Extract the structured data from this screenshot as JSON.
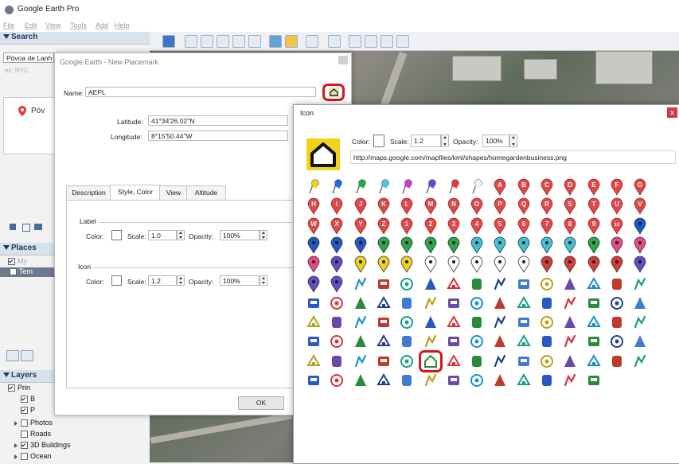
{
  "app": {
    "title": "Google Earth Pro"
  },
  "menu": [
    "File",
    "Edit",
    "View",
    "Tools",
    "Add",
    "Help"
  ],
  "sidebar": {
    "search_header": "Search",
    "search_value": "Póvoa de Lanh",
    "search_hint": "ex: NYC",
    "result_label": "Póv",
    "places_header": "Places",
    "places_items": [
      {
        "label": "My"
      },
      {
        "label": "Tem"
      }
    ],
    "layers_header": "Layers",
    "layers_items": [
      {
        "label": "Prin"
      },
      {
        "label": "B"
      },
      {
        "label": "P"
      },
      {
        "label": "Photos"
      },
      {
        "label": "Roads"
      },
      {
        "label": "3D Buildings"
      },
      {
        "label": "Ocean"
      }
    ]
  },
  "placemark_dialog": {
    "title": "Google Earth - New Placemark",
    "name_label": "Name:",
    "name_value": "AEPL",
    "latitude_label": "Latitude:",
    "latitude_value": "41°34'26.02\"N",
    "longitude_label": "Longitude:",
    "longitude_value": "8°15'50.44\"W",
    "tabs": [
      "Description",
      "Style, Color",
      "View",
      "Altitude"
    ],
    "active_tab": "Style, Color",
    "label_section": "Label",
    "icon_section": "Icon",
    "color_label": "Color:",
    "scale_label": "Scale:",
    "opacity_label": "Opacity:",
    "label_scale": "1.0",
    "label_opacity": "100%",
    "icon_scale": "1.2",
    "icon_opacity": "100%",
    "ok_label": "OK"
  },
  "icon_dialog": {
    "title": "Icon",
    "close": "x",
    "color_label": "Color:",
    "scale_label": "Scale:",
    "scale_value": "1.2",
    "opacity_label": "Opacity:",
    "opacity_value": "100%",
    "url": "http://maps.google.com/mapfiles/kml/shapes/homegardenbusiness.png",
    "pushpin_colors": [
      "#f1d21a",
      "#1f6fd6",
      "#27a84a",
      "#4fc3e8",
      "#c640c8",
      "#6a49c9",
      "#e13a3a",
      "#f3f3f3"
    ],
    "letters": [
      "A",
      "B",
      "C",
      "D",
      "E",
      "F",
      "G",
      "H",
      "I",
      "J",
      "K",
      "L",
      "M",
      "N",
      "O",
      "P",
      "Q",
      "R",
      "S",
      "T",
      "U",
      "V",
      "W",
      "X",
      "Y",
      "Z"
    ],
    "numbers": [
      "1",
      "2",
      "3",
      "4",
      "5",
      "6",
      "7",
      "8",
      "9",
      "10"
    ],
    "dot_colors": [
      "#1f58c9",
      "#1f58c9",
      "#1f58c9",
      "#1f58c9",
      "#27a84a",
      "#27a84a",
      "#27a84a",
      "#27a84a",
      "#40c3d6",
      "#40c3d6",
      "#40c3d6",
      "#40c3d6",
      "#40c3d6",
      "#27a84a",
      "#e74a8a",
      "#e74a8a",
      "#e74a8a",
      "#6a49c9",
      "#f1d21a",
      "#f1d21a",
      "#f1d21a",
      "#ffffff",
      "#ffffff",
      "#ffffff",
      "#ffffff",
      "#ffffff",
      "#d93a3a",
      "#d93a3a",
      "#d93a3a",
      "#d93a3a",
      "#6a49c9",
      "#6a49c9",
      "#6a49c9"
    ],
    "selected_icon": "homegardenbusiness"
  }
}
